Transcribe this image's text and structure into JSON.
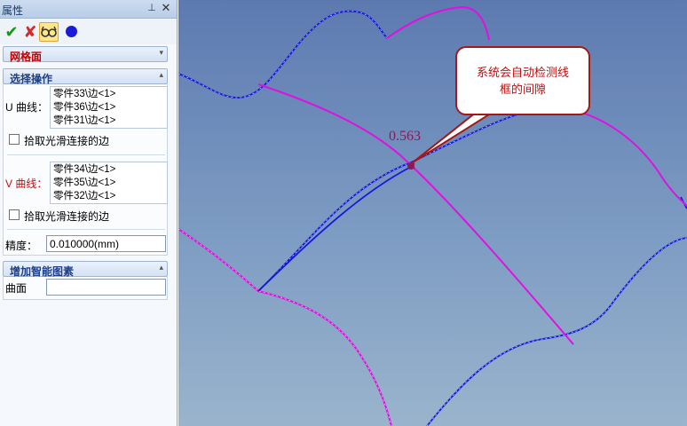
{
  "panel": {
    "title": "属性",
    "pin_icon": "⊥",
    "close_icon": "✕"
  },
  "toolbar": {
    "ok_glyph": "✔",
    "cancel_glyph": "✘"
  },
  "surface_type": {
    "label": "网格面"
  },
  "select_op": {
    "title": "选择操作",
    "u_label": "U 曲线：",
    "u_items": [
      "零件33\\边<1>",
      "零件36\\边<1>",
      "零件31\\边<1>"
    ],
    "u_smooth_label": "拾取光滑连接的边",
    "v_label": "V 曲线：",
    "v_items": [
      "零件34\\边<1>",
      "零件35\\边<1>",
      "零件32\\边<1>"
    ],
    "v_smooth_label": "拾取光滑连接的边",
    "precision_label": "精度：",
    "precision_value": "0.010000(mm)"
  },
  "smart": {
    "title": "增加智能图素",
    "surface_label": "曲面",
    "surface_value": ""
  },
  "viewport": {
    "callout_line1": "系统会自动检测线",
    "callout_line2": "框的间隙",
    "gap_value": "0.563",
    "colors": {
      "u_curve": "#1616e0",
      "v_curve": "#e010e0",
      "callout_border": "#a01a1a",
      "callout_text": "#c20d0d"
    }
  }
}
